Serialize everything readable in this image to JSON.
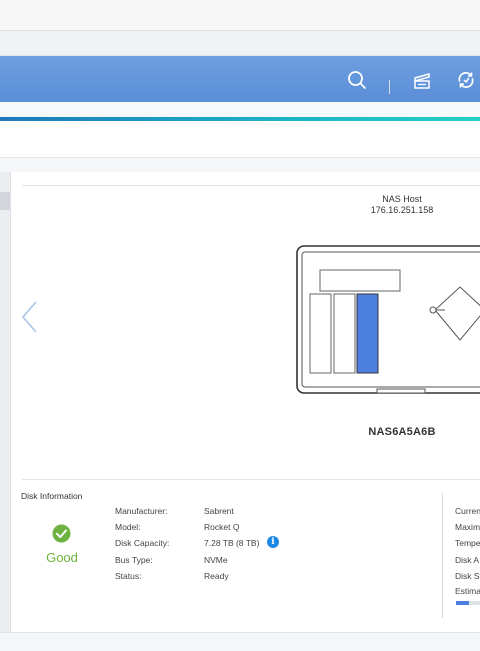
{
  "colors": {
    "header": "#5a8ed8",
    "accent_start": "#1f78b8",
    "accent_end": "#23d1c4",
    "good": "#6db33f",
    "selected_disk": "#4d7fe0",
    "info": "#1e88e5"
  },
  "header": {
    "icons": [
      "search-icon",
      "task-icon",
      "sync-icon"
    ]
  },
  "nas": {
    "host_label": "NAS Host",
    "host_ip": "176.16.251.158",
    "name": "NAS6A5A6B"
  },
  "disk_info": {
    "title": "Disk Information",
    "health": "Good",
    "fields": [
      {
        "label": "Manufacturer:",
        "value": "Sabrent"
      },
      {
        "label": "Model:",
        "value": "Rocket Q"
      },
      {
        "label": "Disk Capacity:",
        "value": "7.28 TB (8 TB)"
      },
      {
        "label": "Bus Type:",
        "value": "NVMe"
      },
      {
        "label": "Status:",
        "value": "Ready"
      }
    ],
    "right_labels": [
      "Curren",
      "Maxim",
      "Tempe",
      "Disk A",
      "Disk S",
      "Estima"
    ]
  },
  "estimate_progress": 0.55
}
